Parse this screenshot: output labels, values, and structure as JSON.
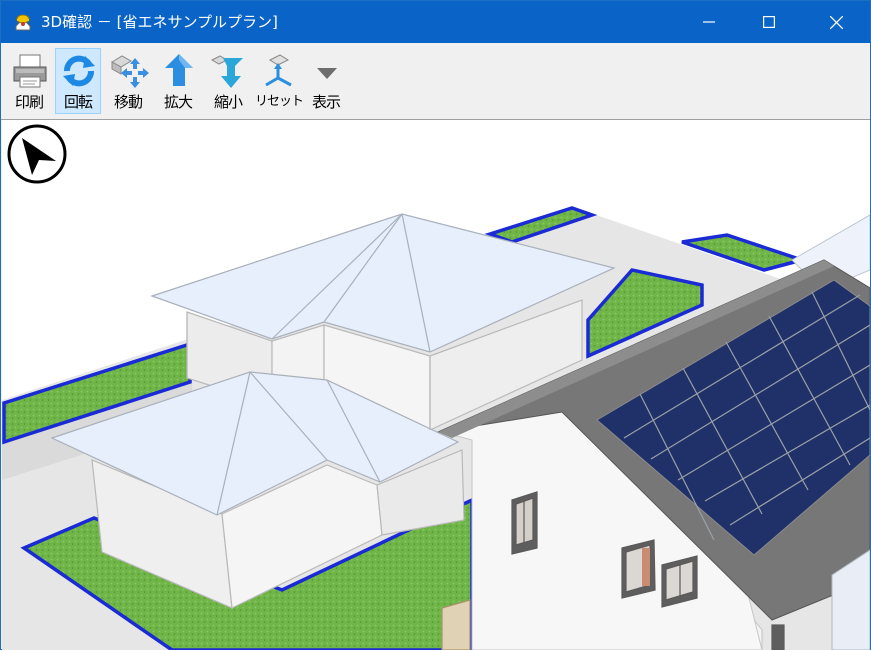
{
  "window": {
    "title": "3D確認 － [省エネサンプルプラン]",
    "app_icon": "house-helmet-icon",
    "controls": {
      "minimize": "minimize-icon",
      "maximize": "maximize-icon",
      "close": "close-icon"
    }
  },
  "toolbar": {
    "buttons": [
      {
        "id": "print",
        "label": "印刷",
        "icon": "printer-icon",
        "selected": false
      },
      {
        "id": "rotate",
        "label": "回転",
        "icon": "rotate-icon",
        "selected": true
      },
      {
        "id": "move",
        "label": "移動",
        "icon": "move-icon",
        "selected": false
      },
      {
        "id": "zoom-in",
        "label": "拡大",
        "icon": "zoom-in-icon",
        "selected": false
      },
      {
        "id": "zoom-out",
        "label": "縮小",
        "icon": "zoom-out-icon",
        "selected": false
      },
      {
        "id": "reset",
        "label": "リセット",
        "icon": "reset-icon",
        "selected": false
      },
      {
        "id": "display",
        "label": "表示",
        "icon": "dropdown-icon",
        "selected": false
      }
    ]
  },
  "viewport": {
    "compass_icon": "north-arrow-icon",
    "colors": {
      "lawn": "#6fb548",
      "lawn_border": "#1a2bd6",
      "ground": "#e4e4e4",
      "roof": "#e6effb",
      "wall": "#f2f2f2",
      "solar_panel": "#1f2f68",
      "roof_dark": "#6b6b6b"
    }
  }
}
